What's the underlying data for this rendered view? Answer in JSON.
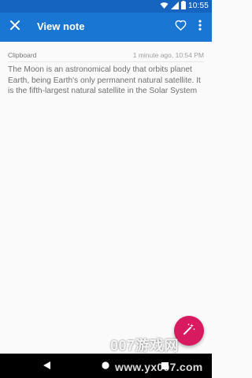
{
  "status_bar": {
    "time": "10:55",
    "icons": [
      "wifi-icon",
      "signal-icon",
      "battery-icon"
    ]
  },
  "app_bar": {
    "title": "View note",
    "close_icon": "close-icon",
    "favorite_icon": "heart-outline-icon",
    "more_icon": "more-vert-icon"
  },
  "note": {
    "source": "Clipboard",
    "timestamp": "1 minute ago, 10:54 PM",
    "body": "The Moon is an astronomical body that orbits planet Earth, being Earth's only permanent natural satellite. It is the fifth-largest natural satellite in the Solar System"
  },
  "fab": {
    "icon": "magic-wand-icon"
  },
  "nav_bar": {
    "icons": [
      "back-icon",
      "home-icon",
      "recents-icon"
    ]
  },
  "watermark": {
    "brand": "007游戏网",
    "url": "www.yx007.com"
  },
  "colors": {
    "status_bar": "#1565c0",
    "app_bar": "#1976d2",
    "fab": "#d81b60",
    "background": "#fafafa",
    "body_text": "#6f6f6f"
  }
}
